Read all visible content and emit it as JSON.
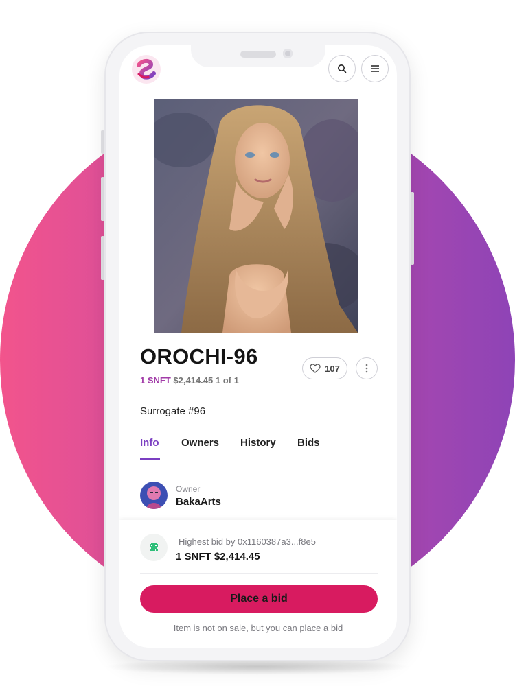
{
  "header": {
    "logo_icon": "brand-logo-icon",
    "search_icon": "search-icon",
    "menu_icon": "hamburger-menu-icon"
  },
  "item": {
    "title": "OROCHI-96",
    "price_token": "1 SNFT",
    "price_usd": "$2,414.45",
    "edition": "1 of 1",
    "likes": "107",
    "subtitle": "Surrogate #96"
  },
  "tabs": [
    {
      "label": "Info",
      "active": true
    },
    {
      "label": "Owners",
      "active": false
    },
    {
      "label": "History",
      "active": false
    },
    {
      "label": "Bids",
      "active": false
    }
  ],
  "owner": {
    "label": "Owner",
    "name": "BakaArts"
  },
  "bid": {
    "label": "Highest bid by 0x1160387a3...f8e5",
    "value": "1 SNFT $2,414.45",
    "button": "Place a bid",
    "note": "Item is not on sale, but you can place a bid"
  },
  "colors": {
    "accent": "#7b3fc2",
    "token": "#a23ca8",
    "button": "#d81b60",
    "background_gradient": [
      "#f2548c",
      "#8e44b6"
    ]
  }
}
